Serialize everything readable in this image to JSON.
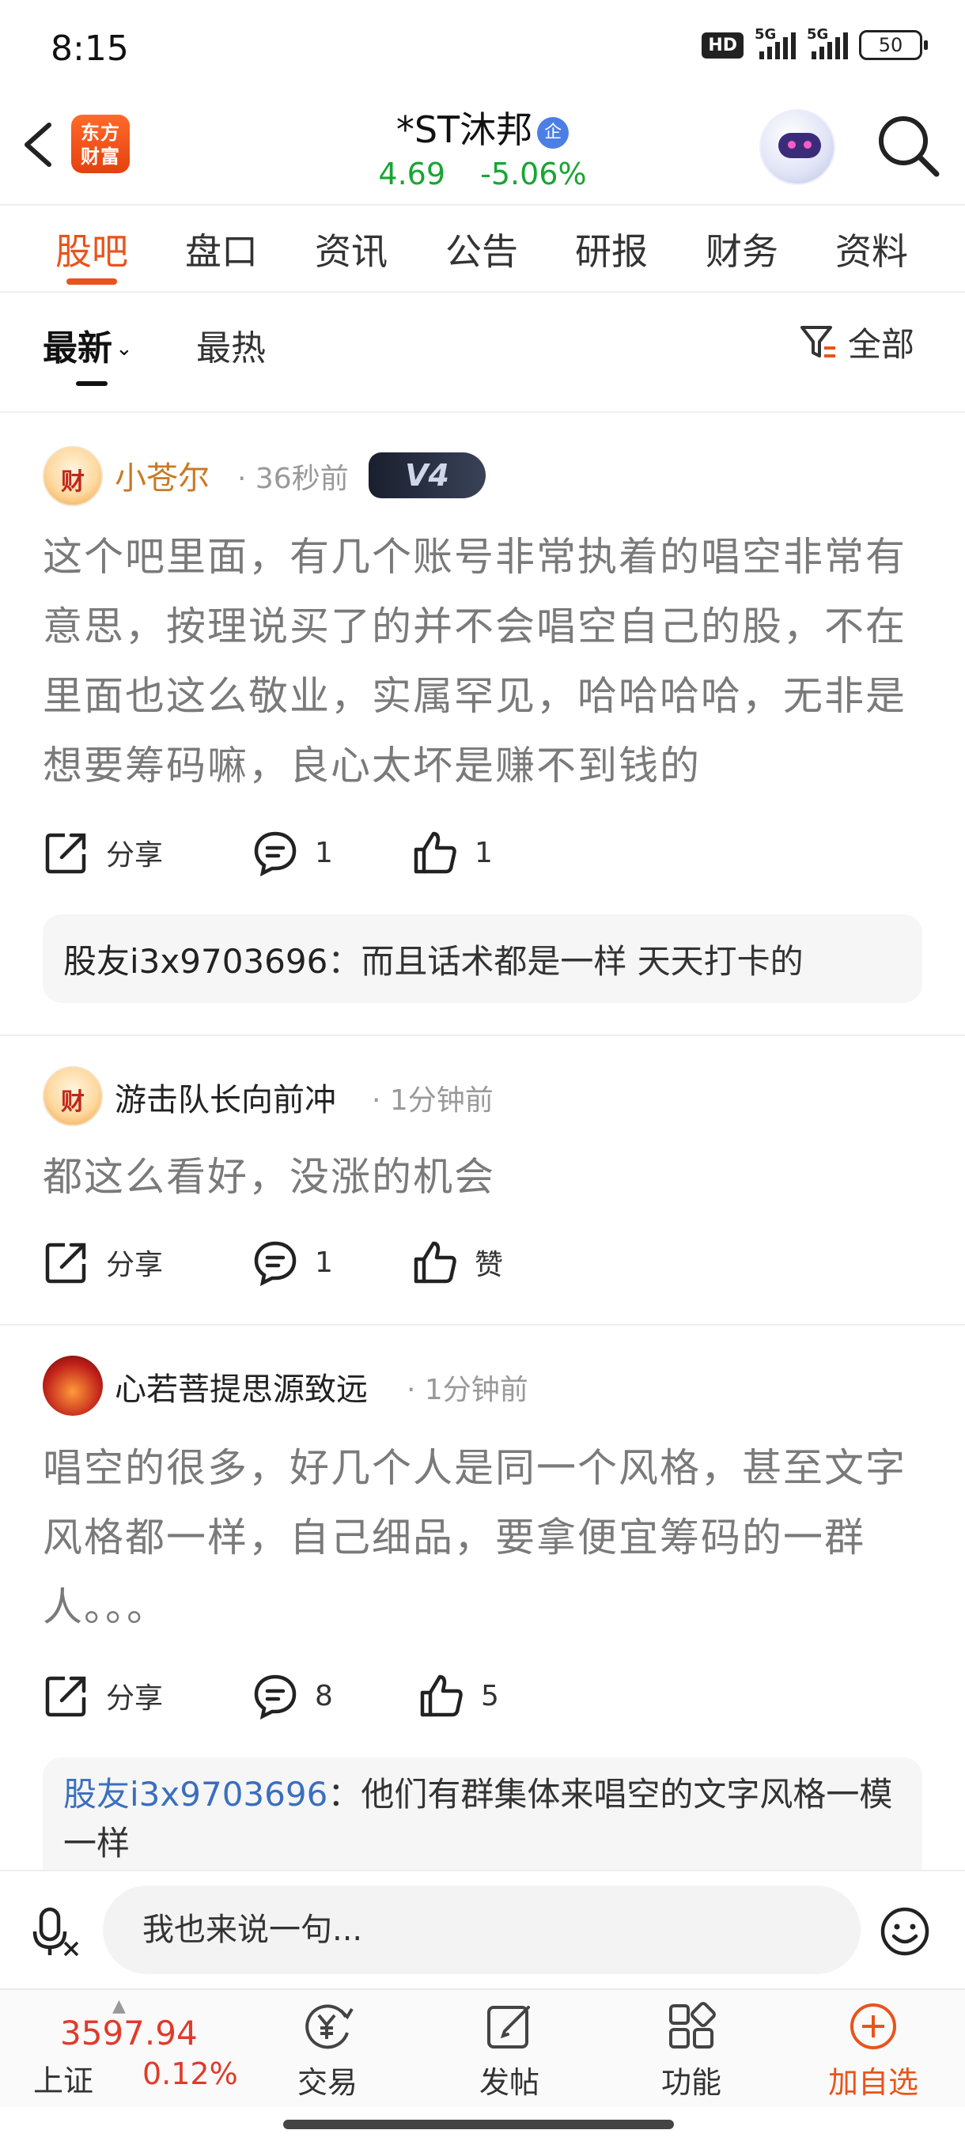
{
  "status": {
    "time": "8:15",
    "hd": "HD",
    "net1": "5G",
    "net2": "5G",
    "battery": "50"
  },
  "header": {
    "logo_line1": "东方",
    "logo_line2": "财富",
    "stock_name": "*ST沐邦",
    "stock_badge": "企",
    "price": "4.69",
    "change_pct": "-5.06%",
    "price_color": "#18a533"
  },
  "tabs": [
    {
      "label": "股吧",
      "active": true
    },
    {
      "label": "盘口"
    },
    {
      "label": "资讯"
    },
    {
      "label": "公告"
    },
    {
      "label": "研报"
    },
    {
      "label": "财务"
    },
    {
      "label": "资料"
    }
  ],
  "sort": {
    "latest": "最新",
    "hot": "最热",
    "filter": "全部"
  },
  "posts": [
    {
      "author": "小苍尔",
      "time": "36秒前",
      "level_badge": "V4",
      "text": "这个吧里面，有几个账号非常执着的唱空非常有意思，按理说买了的并不会唱空自己的股，不在里面也这么敬业，实属罕见，哈哈哈哈，无非是想要筹码嘛，良心太坏是赚不到钱的",
      "share": "分享",
      "comments": "1",
      "likes": "1",
      "reply_user": "股友i3x9703696",
      "reply_text": "：而且话术都是一样  天天打卡的"
    },
    {
      "author": "游击队长向前冲",
      "time": "1分钟前",
      "text": "都这么看好，没涨的机会",
      "share": "分享",
      "comments": "1",
      "likes": "赞"
    },
    {
      "author": "心若菩提思源致远",
      "time": "1分钟前",
      "text": "唱空的很多，好几个人是同一个风格，甚至文字风格都一样，自己细品，要拿便宜筹码的一群人。。。",
      "share": "分享",
      "comments": "8",
      "likes": "5",
      "reply_user": "股友i3x9703696",
      "reply_text": "：他们有群集体来唱空的文字风格一模一样"
    }
  ],
  "input": {
    "placeholder": "我也来说一句..."
  },
  "bottom": {
    "index_value": "3597.94",
    "index_name": "上证",
    "index_pct": "0.12%",
    "trade": "交易",
    "post": "发帖",
    "func": "功能",
    "add_watch": "加自选"
  },
  "colors": {
    "accent": "#e8541b",
    "up": "#e13a2a",
    "down": "#18a533"
  }
}
